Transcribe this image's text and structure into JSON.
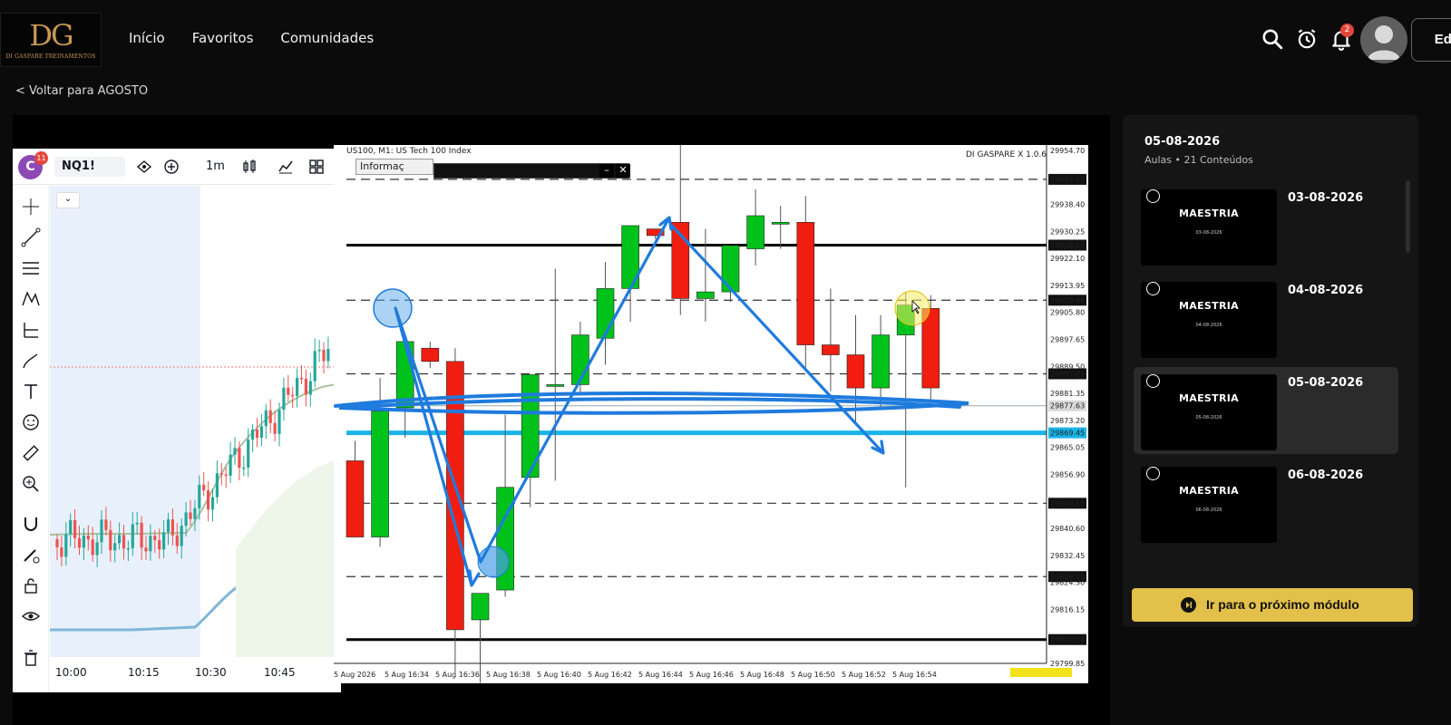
{
  "brand": {
    "logo_mark": "DG",
    "logo_sub": "DI GASPARE TREINAMENTOS"
  },
  "nav": {
    "items": [
      "Início",
      "Favoritos",
      "Comunidades"
    ]
  },
  "header": {
    "notifications_count": "2",
    "edit_label": "Edig"
  },
  "back": {
    "label": "< Voltar para AGOSTO"
  },
  "video": {
    "tv": {
      "avatar_letter": "C",
      "avatar_badge": "11",
      "symbol": "NQ1!",
      "timeframe": "1m",
      "x_labels": [
        "10:00",
        "10:15",
        "10:30",
        "10:45"
      ]
    },
    "mt": {
      "title": "US100, M1: US Tech 100 Index",
      "ea_label": "DI GASPARE X 1.0.6",
      "info_label": "Informaç"
    }
  },
  "chart_data": {
    "type": "candlestick",
    "title": "US100, M1: US Tech 100 Index",
    "price_labels": [
      "29954.70",
      "29945.97",
      "29938.40",
      "29930.25",
      "29926.11",
      "29922.10",
      "29913.95",
      "29909.48",
      "29905.80",
      "29897.65",
      "29889.50",
      "29887.27",
      "29881.35",
      "29877.63",
      "29873.20",
      "29869.45",
      "29865.05",
      "29856.90",
      "29848.19",
      "29840.60",
      "29832.45",
      "29826.05",
      "29824.30",
      "29816.15",
      "29807.04",
      "29799.85"
    ],
    "x_labels": [
      "5 Aug 2026",
      "5 Aug 16:34",
      "5 Aug 16:36",
      "5 Aug 16:38",
      "5 Aug 16:40",
      "5 Aug 16:42",
      "5 Aug 16:44",
      "5 Aug 16:46",
      "5 Aug 16:48",
      "5 Aug 16:50",
      "5 Aug 16:52",
      "5 Aug 16:54"
    ],
    "candles": [
      {
        "o": 29861,
        "h": 29867,
        "l": 29838,
        "c": 29838
      },
      {
        "o": 29838,
        "h": 29886,
        "l": 29835,
        "c": 29876
      },
      {
        "o": 29877,
        "h": 29890,
        "l": 29868,
        "c": 29897
      },
      {
        "o": 29895,
        "h": 29897,
        "l": 29889,
        "c": 29891
      },
      {
        "o": 29891,
        "h": 29895,
        "l": 29797,
        "c": 29810
      },
      {
        "o": 29813,
        "h": 29818,
        "l": 29794,
        "c": 29821
      },
      {
        "o": 29822,
        "h": 29875,
        "l": 29820,
        "c": 29853
      },
      {
        "o": 29856,
        "h": 29880,
        "l": 29847,
        "c": 29887
      },
      {
        "o": 29884,
        "h": 29919,
        "l": 29855,
        "c": 29884
      },
      {
        "o": 29884,
        "h": 29903,
        "l": 29881,
        "c": 29899
      },
      {
        "o": 29898,
        "h": 29921,
        "l": 29890,
        "c": 29913
      },
      {
        "o": 29913,
        "h": 29930,
        "l": 29903,
        "c": 29932
      },
      {
        "o": 29931,
        "h": 29931,
        "l": 29928,
        "c": 29929
      },
      {
        "o": 29933,
        "h": 29957,
        "l": 29905,
        "c": 29910
      },
      {
        "o": 29910,
        "h": 29931,
        "l": 29903,
        "c": 29912
      },
      {
        "o": 29912,
        "h": 29920,
        "l": 29909,
        "c": 29926
      },
      {
        "o": 29925,
        "h": 29943,
        "l": 29920,
        "c": 29935
      },
      {
        "o": 29933,
        "h": 29938,
        "l": 29925,
        "c": 29933
      },
      {
        "o": 29933,
        "h": 29941,
        "l": 29889,
        "c": 29896
      },
      {
        "o": 29896,
        "h": 29913,
        "l": 29882,
        "c": 29893
      },
      {
        "o": 29893,
        "h": 29905,
        "l": 29872,
        "c": 29883
      },
      {
        "o": 29883,
        "h": 29905,
        "l": 29877,
        "c": 29899
      },
      {
        "o": 29899,
        "h": 29912,
        "l": 29853,
        "c": 29908
      },
      {
        "o": 29907,
        "h": 29911,
        "l": 29878,
        "c": 29883
      }
    ]
  },
  "sidebar": {
    "title": "05-08-2026",
    "subtitle": "Aulas • 21 Conteúdos",
    "lessons": [
      {
        "thumb_title": "MAESTRIA",
        "thumb_date": "03-08-2026",
        "date": "03-08-2026"
      },
      {
        "thumb_title": "MAESTRIA",
        "thumb_date": "04-08-2026",
        "date": "04-08-2026"
      },
      {
        "thumb_title": "MAESTRIA",
        "thumb_date": "05-08-2026",
        "date": "05-08-2026"
      },
      {
        "thumb_title": "MAESTRIA",
        "thumb_date": "06-08-2026",
        "date": "06-08-2026"
      }
    ],
    "next_label": "Ir para o próximo módulo"
  },
  "colors": {
    "accent": "#e2c04a",
    "bull": "#00c21b",
    "bear": "#f01e10",
    "annotation": "#1f7bdd"
  }
}
